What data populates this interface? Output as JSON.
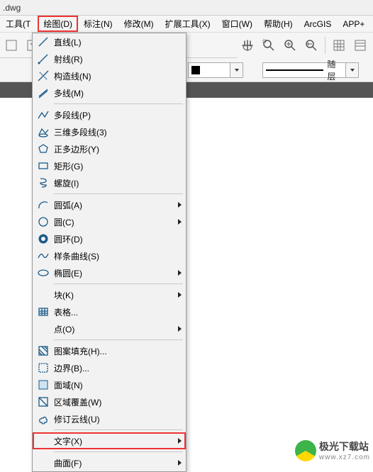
{
  "title": ".dwg",
  "menubar": [
    {
      "label": "工具(T",
      "partial": true
    },
    {
      "label": "绘图(D)",
      "highlight": true
    },
    {
      "label": "标注(N)"
    },
    {
      "label": "修改(M)"
    },
    {
      "label": "扩展工具(X)"
    },
    {
      "label": "窗口(W)"
    },
    {
      "label": "帮助(H)"
    },
    {
      "label": "ArcGIS"
    },
    {
      "label": "APP+"
    }
  ],
  "propbar": {
    "layer_label": "随层",
    "color_hint": "■"
  },
  "dropdown": {
    "items": [
      {
        "icon": "line",
        "label": "直线(L)"
      },
      {
        "icon": "ray",
        "label": "射线(R)"
      },
      {
        "icon": "xline",
        "label": "构造线(N)"
      },
      {
        "icon": "mline",
        "label": "多线(M)"
      },
      {
        "sep": true
      },
      {
        "icon": "pline",
        "label": "多段线(P)"
      },
      {
        "icon": "3dpoly",
        "label": "三维多段线(3)"
      },
      {
        "icon": "polygon",
        "label": "正多边形(Y)"
      },
      {
        "icon": "rect",
        "label": "矩形(G)"
      },
      {
        "icon": "helix",
        "label": "螺旋(I)"
      },
      {
        "sep": true
      },
      {
        "icon": "arc",
        "label": "圆弧(A)",
        "sub": true
      },
      {
        "icon": "circle",
        "label": "圆(C)",
        "sub": true
      },
      {
        "icon": "donut",
        "label": "圆环(D)"
      },
      {
        "icon": "spline",
        "label": "样条曲线(S)"
      },
      {
        "icon": "ellipse",
        "label": "椭圆(E)",
        "sub": true
      },
      {
        "sep": true
      },
      {
        "icon": "block",
        "label": "块(K)",
        "sub": true
      },
      {
        "icon": "table",
        "label": "表格..."
      },
      {
        "icon": "point",
        "label": "点(O)",
        "sub": true
      },
      {
        "sep": true
      },
      {
        "icon": "hatch",
        "label": "图案填充(H)..."
      },
      {
        "icon": "boundary",
        "label": "边界(B)..."
      },
      {
        "icon": "region",
        "label": "面域(N)"
      },
      {
        "icon": "wipeout",
        "label": "区域覆盖(W)"
      },
      {
        "icon": "revcloud",
        "label": "修订云线(U)"
      },
      {
        "sep": true
      },
      {
        "icon": "text",
        "label": "文字(X)",
        "sub": true,
        "highlight": true
      },
      {
        "sep": true
      },
      {
        "icon": "surface",
        "label": "曲面(F)",
        "sub": true
      }
    ]
  },
  "watermark": {
    "title": "极光下载站",
    "sub": "www.xz7.com"
  }
}
